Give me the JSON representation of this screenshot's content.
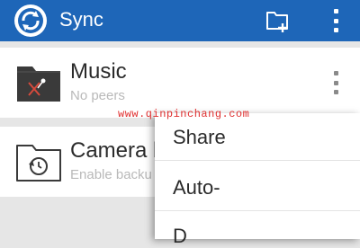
{
  "appbar": {
    "title": "Sync",
    "logo_icon": "sync-logo-icon",
    "add_folder_icon": "folder-add-icon",
    "overflow_icon": "more-vertical-icon",
    "color": "#1e66b8"
  },
  "folders": [
    {
      "title": "Music",
      "subtitle": "No peers",
      "icon": "music-folder-icon"
    },
    {
      "title": "Camera b",
      "subtitle": "Enable backu",
      "icon": "camera-backup-folder-icon"
    }
  ],
  "menu": {
    "items": [
      "Share",
      "Auto-",
      "D"
    ]
  },
  "watermark": "www.qinpinchang.com"
}
